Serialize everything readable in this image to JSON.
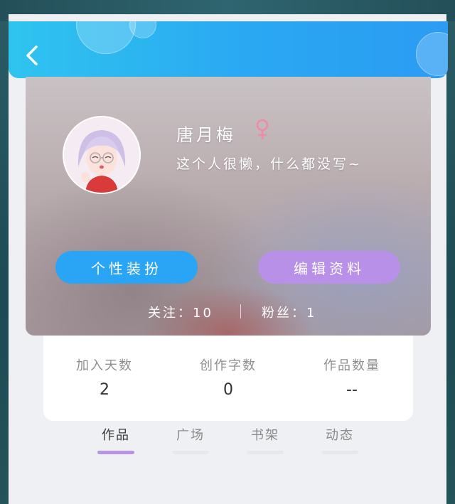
{
  "header": {
    "back_icon": "chevron-left-icon",
    "color_start": "#2fc4ef",
    "color_end": "#2b9cf3"
  },
  "profile": {
    "username": "唐月梅",
    "gender": "female",
    "gender_symbol": "♀",
    "gender_color": "#f08aa8",
    "bio": "这个人很懒，什么都没写~",
    "buttons": {
      "dress_up": "个性装扮",
      "edit_profile": "编辑资料"
    },
    "following_label": "关注：",
    "following_count": "10",
    "fans_label": "粉丝：",
    "fans_count": "1"
  },
  "info": [
    {
      "label": "加入天数",
      "value": "2"
    },
    {
      "label": "创作字数",
      "value": "0"
    },
    {
      "label": "作品数量",
      "value": "--"
    }
  ],
  "tabs": [
    {
      "label": "作品",
      "active": true
    },
    {
      "label": "广场",
      "active": false
    },
    {
      "label": "书架",
      "active": false
    },
    {
      "label": "动态",
      "active": false
    }
  ],
  "colors": {
    "accent_blue": "#2aa4f4",
    "accent_purple": "#b990e8"
  }
}
